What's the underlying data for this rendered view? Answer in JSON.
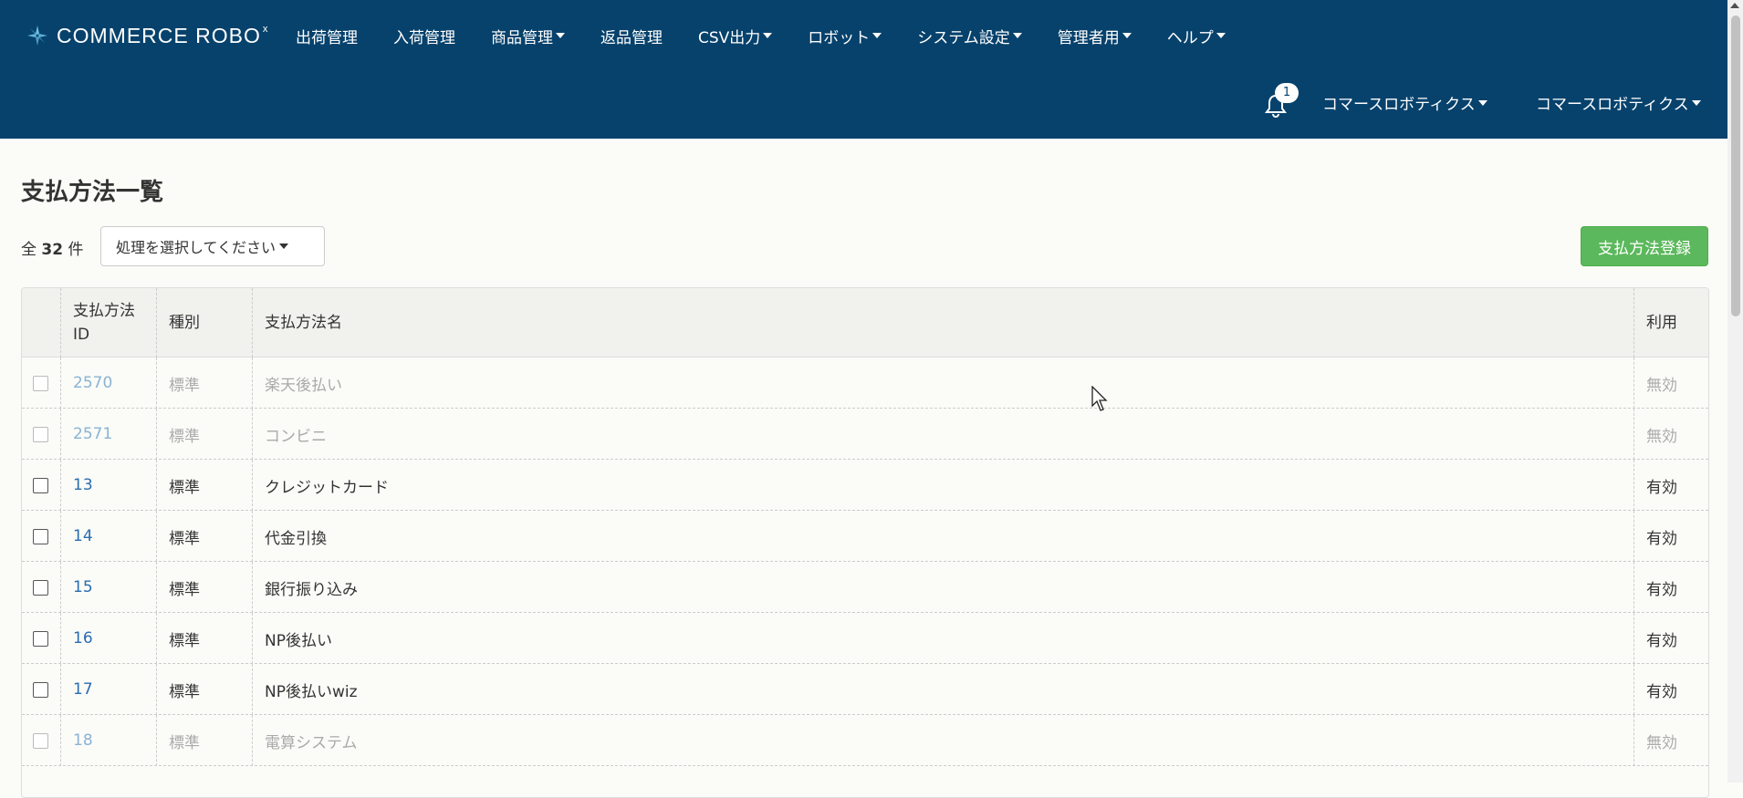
{
  "brand": {
    "name": "COMMERCE ROBO",
    "mark": "x"
  },
  "nav": [
    {
      "label": "出荷管理",
      "dropdown": false
    },
    {
      "label": "入荷管理",
      "dropdown": false
    },
    {
      "label": "商品管理",
      "dropdown": true
    },
    {
      "label": "返品管理",
      "dropdown": false
    },
    {
      "label": "CSV出力",
      "dropdown": true
    },
    {
      "label": "ロボット",
      "dropdown": true
    },
    {
      "label": "システム設定",
      "dropdown": true
    },
    {
      "label": "管理者用",
      "dropdown": true
    },
    {
      "label": "ヘルプ",
      "dropdown": true
    }
  ],
  "notifications": {
    "count": "1"
  },
  "user_menus": [
    "コマースロボティクス",
    "コマースロボティクス"
  ],
  "page": {
    "title": "支払方法一覧",
    "count_prefix": "全",
    "count_value": "32",
    "count_suffix": "件",
    "action_select": "処理を選択してください",
    "register_button": "支払方法登録"
  },
  "table": {
    "headers": {
      "id": "支払方法ID",
      "type": "種別",
      "name": "支払方法名",
      "usage": "利用"
    },
    "rows": [
      {
        "id": "2570",
        "type": "標準",
        "name": "楽天後払い",
        "usage": "無効",
        "enabled": false
      },
      {
        "id": "2571",
        "type": "標準",
        "name": "コンビニ",
        "usage": "無効",
        "enabled": false
      },
      {
        "id": "13",
        "type": "標準",
        "name": "クレジットカード",
        "usage": "有効",
        "enabled": true
      },
      {
        "id": "14",
        "type": "標準",
        "name": "代金引換",
        "usage": "有効",
        "enabled": true
      },
      {
        "id": "15",
        "type": "標準",
        "name": "銀行振り込み",
        "usage": "有効",
        "enabled": true
      },
      {
        "id": "16",
        "type": "標準",
        "name": "NP後払い",
        "usage": "有効",
        "enabled": true
      },
      {
        "id": "17",
        "type": "標準",
        "name": "NP後払いwiz",
        "usage": "有効",
        "enabled": true
      },
      {
        "id": "18",
        "type": "標準",
        "name": "電算システム",
        "usage": "無効",
        "enabled": false
      }
    ]
  },
  "colors": {
    "header_bg": "#07426c",
    "success": "#5cb85c",
    "link": "#2a6cb0"
  }
}
